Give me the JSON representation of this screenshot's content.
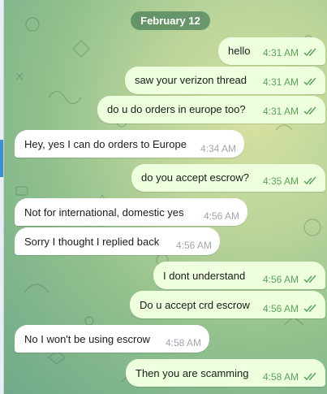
{
  "date_label": "February 12",
  "messages": [
    {
      "direction": "out",
      "text": "hello",
      "time": "4:31 AM",
      "status_icon": "double-check-icon"
    },
    {
      "direction": "out",
      "text": "saw your verizon thread",
      "time": "4:31 AM",
      "status_icon": "double-check-icon"
    },
    {
      "direction": "out",
      "text": "do u do orders in europe too?",
      "time": "4:31 AM",
      "status_icon": "double-check-icon"
    },
    {
      "direction": "in",
      "text": "Hey, yes I can do orders to Europe",
      "time": "4:34 AM"
    },
    {
      "direction": "out",
      "text": "do you accept escrow?",
      "time": "4:35 AM",
      "status_icon": "double-check-icon"
    },
    {
      "direction": "in",
      "text": "Not for international, domestic yes",
      "time": "4:56 AM"
    },
    {
      "direction": "in",
      "text": "Sorry I thought I replied back",
      "time": "4:56 AM"
    },
    {
      "direction": "out",
      "text": "I dont understand",
      "time": "4:56 AM",
      "status_icon": "double-check-icon"
    },
    {
      "direction": "out",
      "text": "Do u accept crd escrow",
      "time": "4:56 AM",
      "status_icon": "double-check-icon"
    },
    {
      "direction": "in",
      "text": "No I won't be using escrow",
      "time": "4:58 AM"
    },
    {
      "direction": "out",
      "text": "Then you are scamming",
      "time": "4:58 AM",
      "status_icon": "double-check-icon"
    }
  ],
  "colors": {
    "outgoing_bubble": "#eeffde",
    "incoming_bubble": "#ffffff",
    "outgoing_meta": "#5aa35a",
    "incoming_meta": "#a0a7ad",
    "date_pill": "#4a7e58"
  }
}
